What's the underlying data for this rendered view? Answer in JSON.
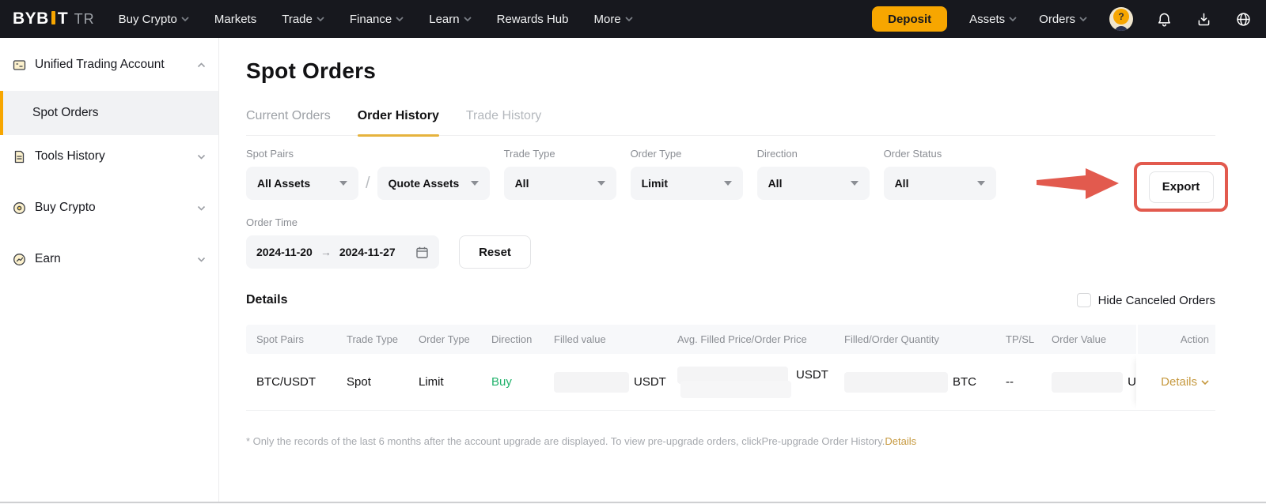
{
  "colors": {
    "accent": "#f7a600",
    "buy_green": "#20b26b",
    "gold_link": "#c6993f",
    "annotation_red": "#e25a4e",
    "nav_bg": "#17181e"
  },
  "topnav": {
    "logo": {
      "main": "BYB",
      "tail": "T",
      "region": "TR"
    },
    "items": [
      {
        "label": "Buy Crypto"
      },
      {
        "label": "Markets"
      },
      {
        "label": "Trade"
      },
      {
        "label": "Finance"
      },
      {
        "label": "Learn"
      },
      {
        "label": "Rewards Hub"
      },
      {
        "label": "More"
      }
    ],
    "deposit_label": "Deposit",
    "assets_label": "Assets",
    "orders_label": "Orders",
    "icons": [
      "help-avatar-icon",
      "bell-icon",
      "download-icon",
      "globe-icon"
    ]
  },
  "sidebar": {
    "items": [
      {
        "label": "Unified Trading Account"
      },
      {
        "label": "Spot Orders"
      },
      {
        "label": "Tools History"
      },
      {
        "label": "Buy Crypto"
      },
      {
        "label": "Earn"
      }
    ]
  },
  "main": {
    "title": "Spot Orders",
    "tabs": [
      {
        "label": "Current Orders"
      },
      {
        "label": "Order History"
      },
      {
        "label": "Trade History"
      }
    ],
    "filters": {
      "spot_pairs": {
        "label": "Spot Pairs",
        "base_value": "All Assets",
        "separator": "/",
        "quote_value": "Quote Assets"
      },
      "trade_type": {
        "label": "Trade Type",
        "value": "All"
      },
      "order_type": {
        "label": "Order Type",
        "value": "Limit"
      },
      "direction": {
        "label": "Direction",
        "value": "All"
      },
      "order_status": {
        "label": "Order Status",
        "value": "All"
      }
    },
    "export_label": "Export",
    "order_time": {
      "label": "Order Time",
      "start": "2024-11-20",
      "arrow": "→",
      "end": "2024-11-27",
      "reset_label": "Reset"
    },
    "details_heading": "Details",
    "hide_canceled_label": "Hide Canceled Orders",
    "table": {
      "columns": [
        "Spot Pairs",
        "Trade Type",
        "Order Type",
        "Direction",
        "Filled value",
        "Avg. Filled Price/Order Price",
        "Filled/Order Quantity",
        "TP/SL",
        "Order Value",
        "Action"
      ],
      "row": {
        "spot_pair": "BTC/USDT",
        "trade_type": "Spot",
        "order_type": "Limit",
        "direction": "Buy",
        "filled_value_unit": "USDT",
        "avg_price_unit": "USDT",
        "quantity_unit": "BTC",
        "tp_sl": "--",
        "order_value_unit": "U",
        "action_label": "Details"
      }
    },
    "footnote": {
      "text": "* Only the records of the last 6 months after the account upgrade are displayed. To view pre-upgrade orders, clickPre-upgrade Order History.",
      "link": "Details"
    }
  }
}
